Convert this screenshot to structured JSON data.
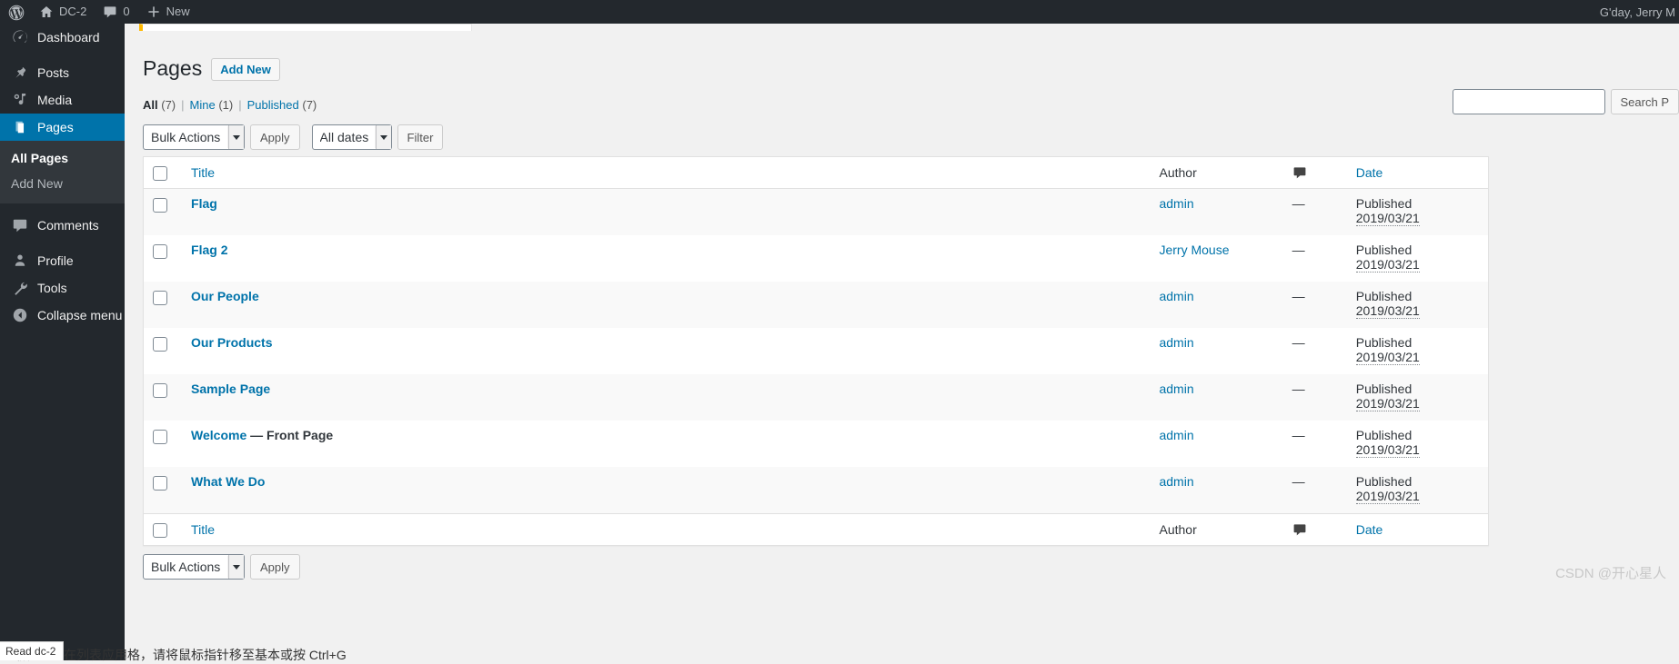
{
  "adminbar": {
    "logo_icon": "wordpress-logo-icon",
    "site_icon": "home-icon",
    "site_name": "DC-2",
    "comments_icon": "comment-bubble-icon",
    "comments_count": "0",
    "new_icon": "plus-icon",
    "new_label": "New",
    "greeting": "G'day, Jerry M"
  },
  "sidebar": {
    "items": [
      {
        "label": "Dashboard",
        "icon": "dashboard-icon",
        "current": false
      },
      {
        "label": "Posts",
        "icon": "pin-icon",
        "current": false
      },
      {
        "label": "Media",
        "icon": "media-icon",
        "current": false
      },
      {
        "label": "Pages",
        "icon": "pages-icon",
        "current": true
      },
      {
        "label": "Comments",
        "icon": "comment-bubble-icon",
        "current": false
      },
      {
        "label": "Profile",
        "icon": "user-icon",
        "current": false
      },
      {
        "label": "Tools",
        "icon": "wrench-icon",
        "current": false
      },
      {
        "label": "Collapse menu",
        "icon": "collapse-arrow-icon",
        "current": false
      }
    ],
    "submenu": [
      {
        "label": "All Pages",
        "current": true
      },
      {
        "label": "Add New",
        "current": false
      }
    ]
  },
  "page": {
    "title": "Pages",
    "add_new_label": "Add New"
  },
  "views": {
    "all_label": "All",
    "all_count": "(7)",
    "mine_label": "Mine",
    "mine_count": "(1)",
    "published_label": "Published",
    "published_count": "(7)",
    "separator": "|"
  },
  "search": {
    "value": "",
    "placeholder": "",
    "button_label": "Search P"
  },
  "tablenav_top": {
    "bulk_actions": "Bulk Actions",
    "apply_label": "Apply",
    "dates": "All dates",
    "filter_label": "Filter"
  },
  "tablenav_bottom": {
    "bulk_actions": "Bulk Actions",
    "apply_label": "Apply"
  },
  "table": {
    "columns": {
      "title": "Title",
      "author": "Author",
      "comments_icon": "comment-bubble-icon",
      "date": "Date"
    },
    "rows": [
      {
        "title": "Flag",
        "state": "",
        "author": "admin",
        "comments": "—",
        "status": "Published",
        "date": "2019/03/21"
      },
      {
        "title": "Flag 2",
        "state": "",
        "author": "Jerry Mouse",
        "comments": "—",
        "status": "Published",
        "date": "2019/03/21"
      },
      {
        "title": "Our People",
        "state": "",
        "author": "admin",
        "comments": "—",
        "status": "Published",
        "date": "2019/03/21"
      },
      {
        "title": "Our Products",
        "state": "",
        "author": "admin",
        "comments": "—",
        "status": "Published",
        "date": "2019/03/21"
      },
      {
        "title": "Sample Page",
        "state": "",
        "author": "admin",
        "comments": "—",
        "status": "Published",
        "date": "2019/03/21"
      },
      {
        "title": "Welcome",
        "state": "— Front Page",
        "author": "admin",
        "comments": "—",
        "status": "Published",
        "date": "2019/03/21"
      },
      {
        "title": "What We Do",
        "state": "",
        "author": "admin",
        "comments": "—",
        "status": "Published",
        "date": "2019/03/21"
      }
    ]
  },
  "status_tip": "Read dc-2",
  "watermark": "CSDN @开心星人",
  "ime_text": "要缩输入字在列表应用格，请将鼠标指针移至基本或按 Ctrl+G",
  "colors": {
    "admin_bar_bg": "#23282d",
    "sidebar_bg": "#23282d",
    "accent": "#0073aa",
    "link": "#0073aa",
    "content_bg": "#f1f1f1",
    "notice_accent": "#ffb900"
  }
}
